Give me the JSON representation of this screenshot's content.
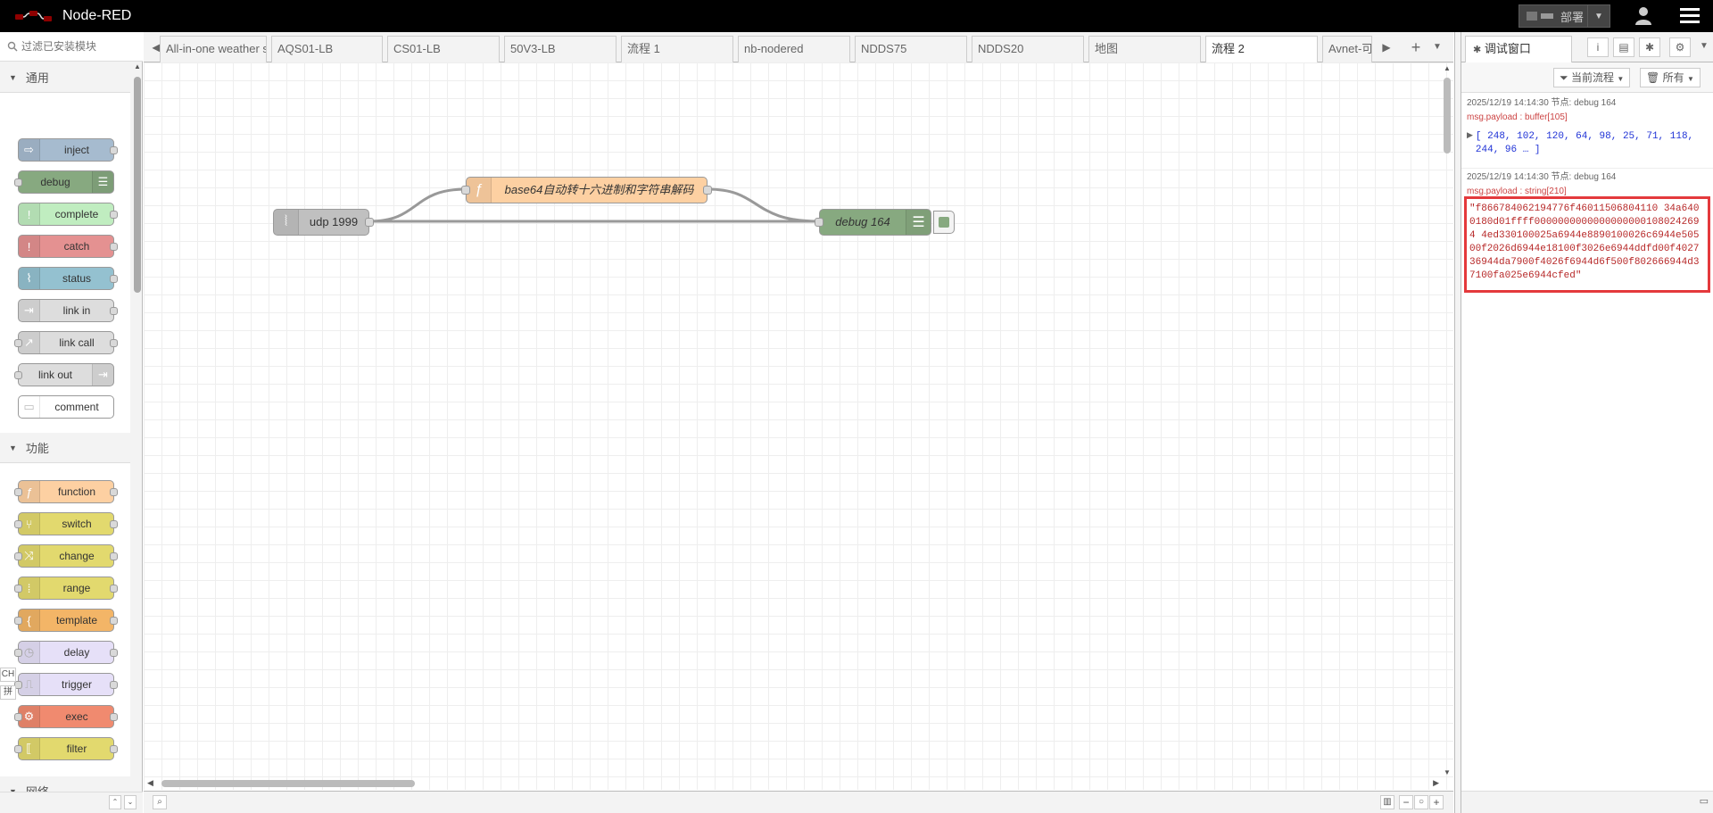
{
  "header": {
    "app_title": "Node-RED",
    "deploy_label": "部署"
  },
  "palette": {
    "search_placeholder": "过滤已安装模块",
    "categories": [
      {
        "label": "通用",
        "nodes": [
          {
            "label": "inject",
            "color": "#a6bbcf",
            "icon": "arrow-right-icon"
          },
          {
            "label": "debug",
            "color": "#87a980",
            "icon": "list-icon"
          },
          {
            "label": "complete",
            "color": "#c0edc0",
            "icon": "exclamation-icon"
          },
          {
            "label": "catch",
            "color": "#e49191",
            "icon": "exclamation-icon"
          },
          {
            "label": "status",
            "color": "#94c1d0",
            "icon": "pulse-icon"
          },
          {
            "label": "link in",
            "color": "#dddddd",
            "icon": "link-in-icon"
          },
          {
            "label": "link call",
            "color": "#dddddd",
            "icon": "link-call-icon"
          },
          {
            "label": "link out",
            "color": "#dddddd",
            "icon": "link-out-icon"
          },
          {
            "label": "comment",
            "color": "#ffffff",
            "icon": "comment-icon"
          }
        ]
      },
      {
        "label": "功能",
        "nodes": [
          {
            "label": "function",
            "color": "#fdd0a2",
            "icon": "function-icon"
          },
          {
            "label": "switch",
            "color": "#e2d96e",
            "icon": "switch-icon"
          },
          {
            "label": "change",
            "color": "#e2d96e",
            "icon": "shuffle-icon"
          },
          {
            "label": "range",
            "color": "#e2d96e",
            "icon": "range-icon"
          },
          {
            "label": "template",
            "color": "#f3b567",
            "icon": "template-icon"
          },
          {
            "label": "delay",
            "color": "#e6e0f8",
            "icon": "timer-icon"
          },
          {
            "label": "trigger",
            "color": "#e6e0f8",
            "icon": "trigger-icon"
          },
          {
            "label": "exec",
            "color": "#f08a6f",
            "icon": "gear-icon"
          },
          {
            "label": "filter",
            "color": "#e2d96e",
            "icon": "filter-icon"
          }
        ]
      },
      {
        "label": "网络",
        "nodes": []
      }
    ],
    "ime_labels": [
      "CH",
      "拼"
    ]
  },
  "tabs": [
    {
      "label": "All-in-one weather s"
    },
    {
      "label": "AQS01-LB"
    },
    {
      "label": "CS01-LB"
    },
    {
      "label": "50V3-LB"
    },
    {
      "label": "流程 1"
    },
    {
      "label": "nb-nodered"
    },
    {
      "label": "NDDS75"
    },
    {
      "label": "NDDS20"
    },
    {
      "label": "地图"
    },
    {
      "label": "流程 2"
    },
    {
      "label": "Avnet-可视"
    }
  ],
  "flow": {
    "nodes": [
      {
        "label": "udp 1999",
        "color": "#c0c0c0"
      },
      {
        "label": "base64自动转十六进制和字符串解码",
        "color": "#fdd0a2"
      },
      {
        "label": "debug 164",
        "color": "#87a980"
      }
    ]
  },
  "sidebar": {
    "tab_label": "调试窗口",
    "filter_flow": "当前流程",
    "filter_all": "所有",
    "messages": [
      {
        "meta": "2025/12/19 14:14:30   节点: debug 164",
        "path": "msg.payload : buffer[105]",
        "body": "[ 248, 102, 120, 64, 98, 25, 71, 118, 244, 96 … ]"
      },
      {
        "meta": "2025/12/19 14:14:30   节点: debug 164",
        "path": "msg.payload : string[210]",
        "body": "\"f866784062194776f46011506804110 34a6400180d01ffff00000000000000000001080242694 4ed330100025a6944e8890100026c6944e50500f2026d6944e18100f3026e6944ddfd00f402736944da7900f4026f6944d6f500f802666944d37100fa025e6944cfed\""
      }
    ],
    "colors": {
      "number": "#2033d6",
      "string": "#b72828",
      "highlight": "#e4393c"
    }
  }
}
